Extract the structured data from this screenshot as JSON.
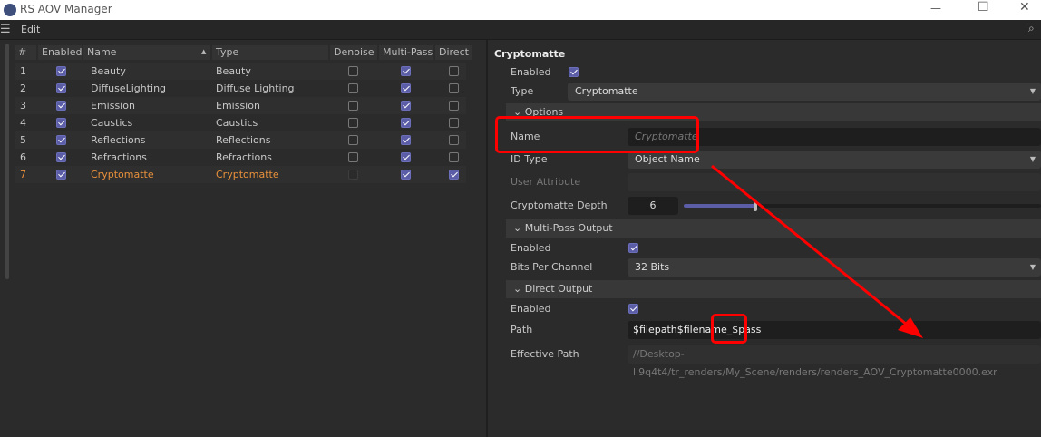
{
  "window": {
    "title": "RS AOV Manager"
  },
  "menu": {
    "edit": "Edit"
  },
  "table": {
    "headers": [
      "#",
      "Enabled",
      "Name",
      "Type",
      "Denoise",
      "Multi-Pass",
      "Direct"
    ],
    "rows": [
      {
        "num": "1",
        "enabled": true,
        "name": "Beauty",
        "type": "Beauty",
        "denoise": false,
        "multipass": true,
        "direct": false
      },
      {
        "num": "2",
        "enabled": true,
        "name": "DiffuseLighting",
        "type": "Diffuse Lighting",
        "denoise": false,
        "multipass": true,
        "direct": false
      },
      {
        "num": "3",
        "enabled": true,
        "name": "Emission",
        "type": "Emission",
        "denoise": false,
        "multipass": true,
        "direct": false
      },
      {
        "num": "4",
        "enabled": true,
        "name": "Caustics",
        "type": "Caustics",
        "denoise": false,
        "multipass": true,
        "direct": false
      },
      {
        "num": "5",
        "enabled": true,
        "name": "Reflections",
        "type": "Reflections",
        "denoise": false,
        "multipass": true,
        "direct": false
      },
      {
        "num": "6",
        "enabled": true,
        "name": "Refractions",
        "type": "Refractions",
        "denoise": false,
        "multipass": true,
        "direct": false
      },
      {
        "num": "7",
        "enabled": true,
        "name": "Cryptomatte",
        "type": "Cryptomatte",
        "denoise": false,
        "multipass": true,
        "direct": true,
        "selected": true
      }
    ]
  },
  "props": {
    "title": "Cryptomatte",
    "enabled_label": "Enabled",
    "enabled": true,
    "type_label": "Type",
    "type_value": "Cryptomatte",
    "options_label": "Options",
    "name_label": "Name",
    "name_placeholder": "Cryptomatte",
    "idtype_label": "ID Type",
    "idtype_value": "Object Name",
    "userattr_label": "User Attribute",
    "depth_label": "Cryptomatte Depth",
    "depth_value": "6",
    "depth_fraction": 0.2,
    "multipass_label": "Multi-Pass Output",
    "mp_enabled_label": "Enabled",
    "mp_enabled": true,
    "bits_label": "Bits Per Channel",
    "bits_value": "32 Bits",
    "direct_label": "Direct Output",
    "do_enabled_label": "Enabled",
    "do_enabled": true,
    "path_label": "Path",
    "path_value": "$filepath$filename_$pass",
    "effpath_label": "Effective Path",
    "effpath_value": "//Desktop-li9q4t4/tr_renders/My_Scene/renders/renders_AOV_Cryptomatte0000.exr"
  },
  "colors": {
    "accent": "#5b5ea6",
    "selected": "#e8903a",
    "annotation": "#ff0000"
  }
}
